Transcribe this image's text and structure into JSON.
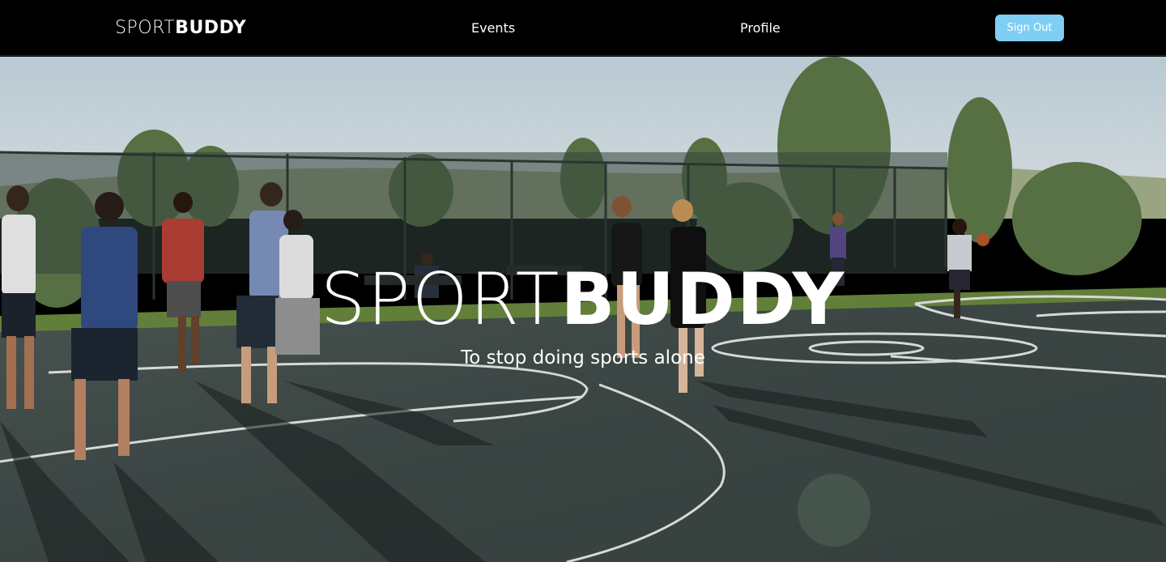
{
  "navbar": {
    "logo_light": "SPORT",
    "logo_bold": "BUDDY",
    "links": [
      "Events",
      "Profile"
    ],
    "signout_label": "Sign Out"
  },
  "hero": {
    "title_light": "SPORT",
    "title_bold": "BUDDY",
    "subtitle": "To stop doing sports alone"
  },
  "colors": {
    "navbar_bg": "#000000",
    "button_bg": "#7fcff5",
    "text": "#ffffff"
  }
}
